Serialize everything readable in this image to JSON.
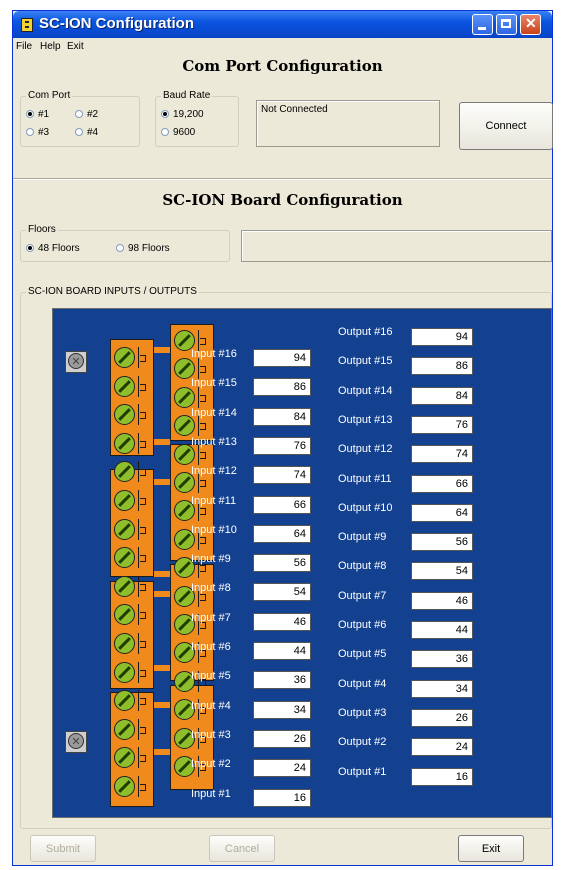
{
  "window": {
    "title": "SC-ION Configuration"
  },
  "menu": {
    "file": "File",
    "help": "Help",
    "exit": "Exit"
  },
  "com_section": {
    "title": "Com Port Configuration",
    "com_port": {
      "label": "Com Port",
      "options": [
        "#1",
        "#2",
        "#3",
        "#4"
      ],
      "selected": "#1"
    },
    "baud_rate": {
      "label": "Baud Rate",
      "options": [
        "19,200",
        "9600"
      ],
      "selected": "19,200"
    },
    "status": "Not Connected",
    "connect_label": "Connect"
  },
  "board_section": {
    "title": "SC-ION Board Configuration",
    "floors": {
      "label": "Floors",
      "options": [
        "48 Floors",
        "98 Floors"
      ],
      "selected": "48 Floors"
    },
    "info_text": ""
  },
  "io_section": {
    "label": "SC-ION BOARD INPUTS / OUTPUTS",
    "inputs": [
      {
        "label": "Input #16",
        "value": "94"
      },
      {
        "label": "Input #15",
        "value": "86"
      },
      {
        "label": "Input #14",
        "value": "84"
      },
      {
        "label": "Input #13",
        "value": "76"
      },
      {
        "label": "Input #12",
        "value": "74"
      },
      {
        "label": "Input #11",
        "value": "66"
      },
      {
        "label": "Input #10",
        "value": "64"
      },
      {
        "label": "Input #9",
        "value": "56"
      },
      {
        "label": "Input #8",
        "value": "54"
      },
      {
        "label": "Input #7",
        "value": "46"
      },
      {
        "label": "Input #6",
        "value": "44"
      },
      {
        "label": "Input #5",
        "value": "36"
      },
      {
        "label": "Input #4",
        "value": "34"
      },
      {
        "label": "Input #3",
        "value": "26"
      },
      {
        "label": "Input #2",
        "value": "24"
      },
      {
        "label": "Input #1",
        "value": "16"
      }
    ],
    "outputs": [
      {
        "label": "Output #16",
        "value": "94"
      },
      {
        "label": "Output #15",
        "value": "86"
      },
      {
        "label": "Output #14",
        "value": "84"
      },
      {
        "label": "Output #13",
        "value": "76"
      },
      {
        "label": "Output #12",
        "value": "74"
      },
      {
        "label": "Output #11",
        "value": "66"
      },
      {
        "label": "Output #10",
        "value": "64"
      },
      {
        "label": "Output #9",
        "value": "56"
      },
      {
        "label": "Output #8",
        "value": "54"
      },
      {
        "label": "Output #7",
        "value": "46"
      },
      {
        "label": "Output #6",
        "value": "44"
      },
      {
        "label": "Output #5",
        "value": "36"
      },
      {
        "label": "Output #4",
        "value": "34"
      },
      {
        "label": "Output #3",
        "value": "26"
      },
      {
        "label": "Output #2",
        "value": "24"
      },
      {
        "label": "Output #1",
        "value": "16"
      }
    ]
  },
  "buttons": {
    "submit": "Submit",
    "cancel": "Cancel",
    "exit": "Exit"
  },
  "icons": {
    "app": "app-icon",
    "minimize": "minimize-icon",
    "maximize": "maximize-icon",
    "close": "close-icon"
  },
  "colors": {
    "titlebar": "#0a55e0",
    "panel": "#13418f",
    "terminal_block": "#f08a1c",
    "screw": "#8fbe2c",
    "window_bg": "#ece9d8"
  }
}
